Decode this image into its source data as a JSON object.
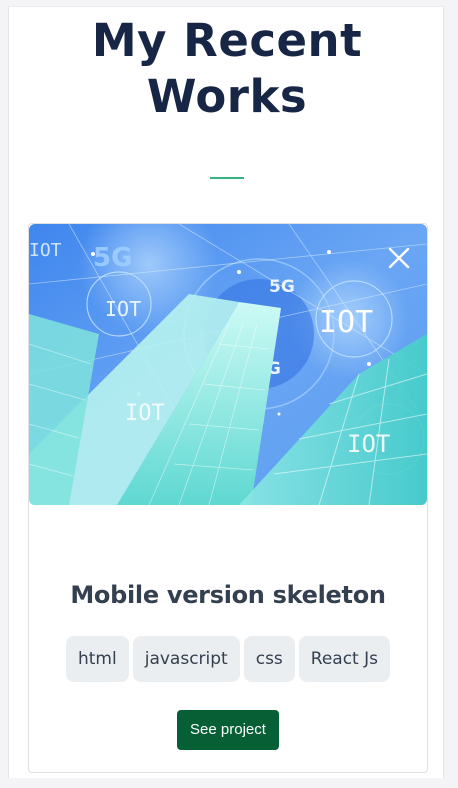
{
  "section": {
    "title_line1": "My Recent",
    "title_line2": "Works"
  },
  "card": {
    "image_alt": "5G IoT city towers",
    "image_labels": [
      "5G",
      "IOT",
      "5G",
      "IOT",
      "5G",
      "IOT",
      "IOT",
      "IOT"
    ],
    "title": "Mobile version skeleton",
    "tags": [
      "html",
      "javascript",
      "css",
      "React Js"
    ],
    "button_label": "See project"
  },
  "colors": {
    "title": "#172645",
    "divider": "#36b37e",
    "button": "#075f35",
    "tag_bg": "#ebeef0"
  },
  "icons": {
    "close": "close-icon"
  }
}
